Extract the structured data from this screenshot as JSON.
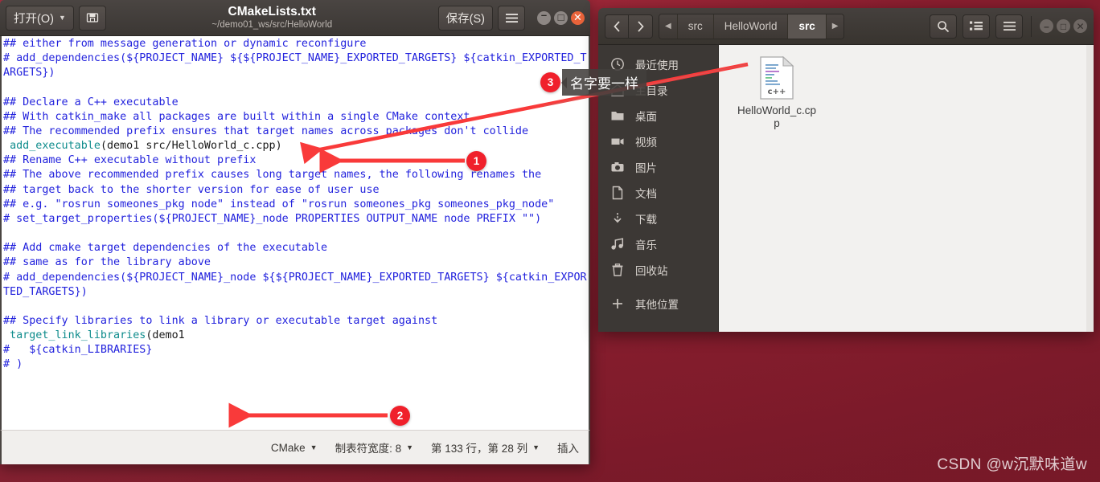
{
  "editor": {
    "open_label": "打开(O)",
    "open_caret": "▼",
    "saveas_icon": "save-as-icon",
    "title": "CMakeLists.txt",
    "subtitle": "~/demo01_ws/src/HelloWorld",
    "save_label": "保存(S)",
    "menu_icon": "hamburger-menu-icon",
    "window_controls": {
      "minimize": "–",
      "maximize": "□",
      "close": "✕"
    },
    "code_lines": [
      {
        "text": "## either from message generation or dynamic reconfigure",
        "type": "comment"
      },
      {
        "text": "# add_dependencies(${PROJECT_NAME} ${${PROJECT_NAME}_EXPORTED_TARGETS} ${catkin_EXPORTED_TARGETS})",
        "type": "comment"
      },
      {
        "text": "",
        "type": "blank"
      },
      {
        "text": "## Declare a C++ executable",
        "type": "comment"
      },
      {
        "text": "## With catkin_make all packages are built within a single CMake context",
        "type": "comment"
      },
      {
        "text": "## The recommended prefix ensures that target names across packages don't collide",
        "type": "comment"
      },
      {
        "text": " add_executable(demo1 src/HelloWorld_c.cpp)",
        "type": "code",
        "fn": "add_executable",
        "args": "(demo1 src/HelloWorld_c.cpp)"
      },
      {
        "text": "## Rename C++ executable without prefix",
        "type": "comment"
      },
      {
        "text": "## The above recommended prefix causes long target names, the following renames the",
        "type": "comment"
      },
      {
        "text": "## target back to the shorter version for ease of user use",
        "type": "comment"
      },
      {
        "text": "## e.g. \"rosrun someones_pkg node\" instead of \"rosrun someones_pkg someones_pkg_node\"",
        "type": "comment"
      },
      {
        "text": "# set_target_properties(${PROJECT_NAME}_node PROPERTIES OUTPUT_NAME node PREFIX \"\")",
        "type": "comment"
      },
      {
        "text": "",
        "type": "blank"
      },
      {
        "text": "## Add cmake target dependencies of the executable",
        "type": "comment"
      },
      {
        "text": "## same as for the library above",
        "type": "comment"
      },
      {
        "text": "# add_dependencies(${PROJECT_NAME}_node ${${PROJECT_NAME}_EXPORTED_TARGETS} ${catkin_EXPORTED_TARGETS})",
        "type": "comment"
      },
      {
        "text": "",
        "type": "blank"
      },
      {
        "text": "## Specify libraries to link a library or executable target against",
        "type": "comment"
      },
      {
        "text": " target_link_libraries(demo1",
        "type": "code",
        "fn": "target_link_libraries",
        "args": "(demo1"
      },
      {
        "text": "#   ${catkin_LIBRARIES}",
        "type": "comment"
      },
      {
        "text": "# )",
        "type": "comment"
      }
    ],
    "code_text": "## either from message generation or dynamic reconfigure\n# add_dependencies(${PROJECT_NAME} ${${PROJECT_NAME}_EXPORTED_TARGETS} ${catkin_EXPORTED_TARGETS})\n\n## Declare a C++ executable\n## With catkin_make all packages are built within a single CMake context\n## The recommended prefix ensures that target names across packages don't collide",
    "status": {
      "language": "CMake",
      "tab_width": "制表符宽度: 8",
      "position": "第 133 行，第 28 列",
      "insert_mode": "插入",
      "caret": "▼"
    }
  },
  "filemanager": {
    "nav_back": "‹",
    "nav_forward": "›",
    "breadcrumbs": [
      {
        "label": "◀",
        "type": "arrow"
      },
      {
        "label": "src",
        "type": "crumb"
      },
      {
        "label": "HelloWorld",
        "type": "crumb"
      },
      {
        "label": "src",
        "type": "crumb",
        "active": true
      },
      {
        "label": "▶",
        "type": "arrow"
      }
    ],
    "toolbar": {
      "search_icon": "search-icon",
      "view_icon": "list-view-icon",
      "menu_icon": "hamburger-menu-icon"
    },
    "window_controls": {
      "minimize": "–",
      "maximize": "□",
      "close": "✕"
    },
    "sidebar": [
      {
        "label": "最近使用",
        "icon": "clock-icon"
      },
      {
        "label": "主目录",
        "icon": "home-icon"
      },
      {
        "label": "桌面",
        "icon": "folder-icon"
      },
      {
        "label": "视频",
        "icon": "video-icon"
      },
      {
        "label": "图片",
        "icon": "camera-icon"
      },
      {
        "label": "文档",
        "icon": "document-icon"
      },
      {
        "label": "下载",
        "icon": "download-icon"
      },
      {
        "label": "音乐",
        "icon": "music-icon"
      },
      {
        "label": "回收站",
        "icon": "trash-icon"
      },
      {
        "label": "其他位置",
        "icon": "plus-icon"
      }
    ],
    "files": [
      {
        "name": "HelloWorld_c.cpp",
        "icon": "cpp-file-icon",
        "badge": "c++"
      }
    ]
  },
  "annotations": {
    "badge1": "1",
    "badge2": "2",
    "badge3": "3",
    "tip3": "名字要一样",
    "accent_color": "#f0202b"
  },
  "watermark": "CSDN @w沉默味道w"
}
